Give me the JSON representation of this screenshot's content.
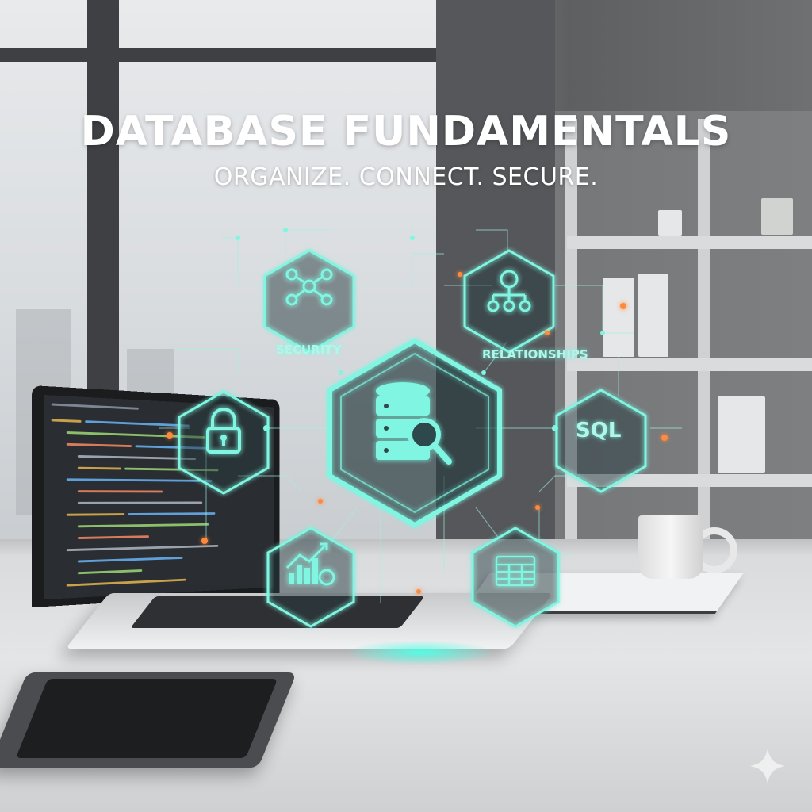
{
  "title": "DATABASE FUNDAMENTALS",
  "subtitle": "ORGANIZE. CONNECT. SECURE.",
  "labels": {
    "security": "SECURITY",
    "relationships": "RELATIONSHIPS",
    "sql": "SQL"
  },
  "icons": [
    "network-nodes-icon",
    "hierarchy-icon",
    "padlock-icon",
    "database-search-icon",
    "sql-icon",
    "bar-chart-icon",
    "table-grid-icon",
    "sparkle-icon"
  ],
  "colors": {
    "holo_cyan": "#7ff5e2",
    "accent_orange": "#ff8a3d",
    "title_white": "#ffffff"
  }
}
